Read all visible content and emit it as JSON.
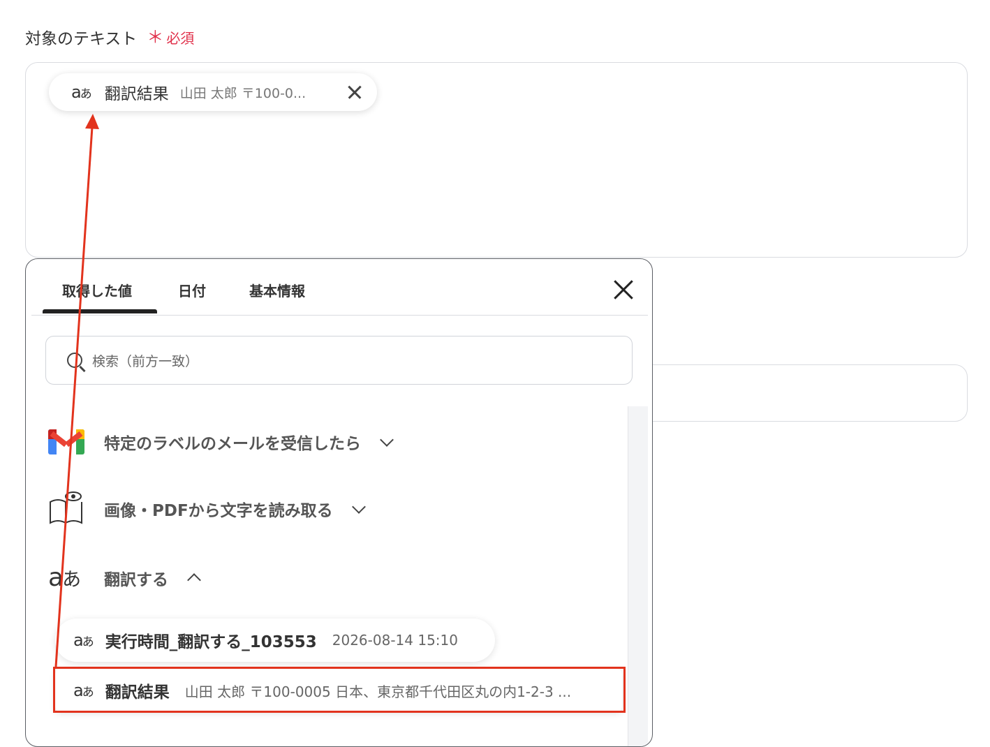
{
  "field": {
    "label": "対象のテキスト",
    "required_mark": "＊",
    "required_label": "必須"
  },
  "chip": {
    "icon": "aa-translate-icon",
    "name": "翻訳結果",
    "value": "山田 太郎 〒100-0..."
  },
  "popup": {
    "tabs": [
      {
        "label": "取得した値",
        "active": true
      },
      {
        "label": "日付",
        "active": false
      },
      {
        "label": "基本情報",
        "active": false
      }
    ],
    "search_placeholder": "検索（前方一致）",
    "groups": [
      {
        "icon": "gmail-icon",
        "label": "特定のラベルのメールを受信したら",
        "expanded": false
      },
      {
        "icon": "ocr-book-icon",
        "label": "画像・PDFから文字を読み取る",
        "expanded": false
      },
      {
        "icon": "aa-translate-icon",
        "label": "翻訳する",
        "expanded": true
      }
    ],
    "items": [
      {
        "icon": "aa-translate-icon",
        "name": "実行時間_翻訳する_103553",
        "value": "2026-08-14 15:10"
      },
      {
        "icon": "aa-translate-icon",
        "name": "翻訳結果",
        "value": "山田 太郎 〒100-0005 日本、東京都千代田区丸の内1-2-3 ..."
      }
    ]
  },
  "annotation": {
    "color": "#e2331d"
  }
}
